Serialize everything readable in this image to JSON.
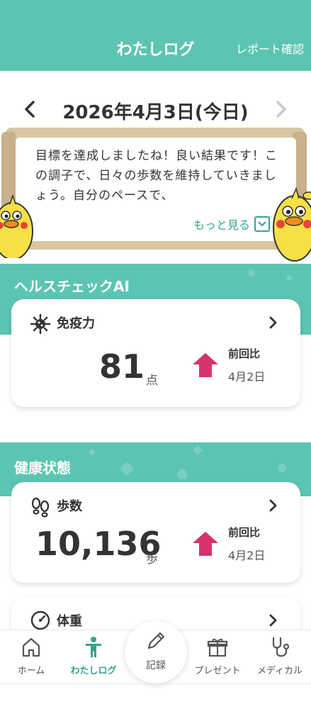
{
  "header": {
    "title": "わたしログ",
    "action": "レポート確認"
  },
  "date_nav": {
    "date": "2026年4月3日(今日)"
  },
  "message": {
    "text": "目標を達成しましたね！良い結果です！この調子で、日々の歩数を維持していきましょう。自分のペースで、",
    "more": "もっと見る"
  },
  "health_check": {
    "section_title": "ヘルスチェックAI",
    "card": {
      "title": "免疫力",
      "value": "81",
      "unit": "点",
      "compare_label": "前回比",
      "compare_date": "4月2日",
      "trend": "up"
    }
  },
  "health_status": {
    "section_title": "健康状態",
    "steps_card": {
      "title": "歩数",
      "value": "10,136",
      "unit": "歩",
      "compare_label": "前回比",
      "compare_date": "4月2日",
      "trend": "up"
    },
    "weight_card": {
      "title": "体重"
    }
  },
  "bottom_nav": {
    "items": [
      {
        "label": "ホーム",
        "icon": "home-icon"
      },
      {
        "label": "わたしログ",
        "icon": "person-icon"
      },
      {
        "label": "記録",
        "icon": "pencil-icon"
      },
      {
        "label": "プレゼント",
        "icon": "gift-icon"
      },
      {
        "label": "メディカル",
        "icon": "stethoscope-icon"
      }
    ],
    "active": "わたしログ"
  },
  "colors": {
    "brand": "#5cc5b2",
    "accent_text": "#3aa28f",
    "trend_up": "#d6336c"
  }
}
